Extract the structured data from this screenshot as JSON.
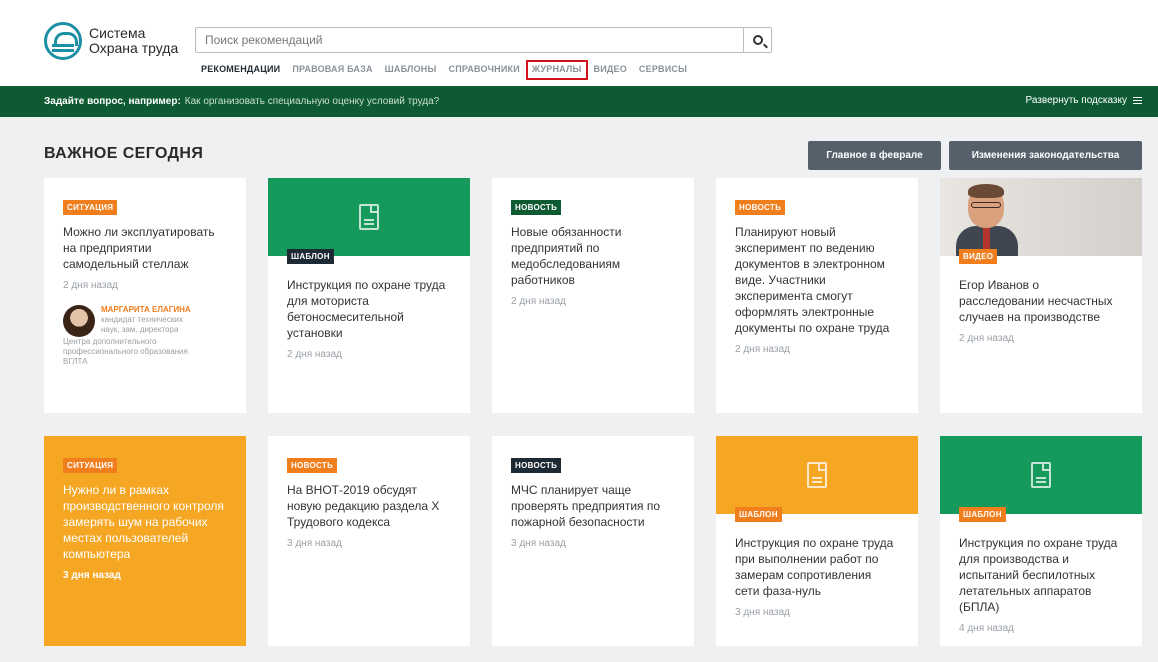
{
  "logo": {
    "line1": "Система",
    "line2": "Охрана труда"
  },
  "search": {
    "placeholder": "Поиск рекомендаций",
    "icon": "search-icon"
  },
  "nav": {
    "items": [
      {
        "label": "РЕКОМЕНДАЦИИ",
        "state": "active"
      },
      {
        "label": "ПРАВОВАЯ БАЗА",
        "state": ""
      },
      {
        "label": "ШАБЛОНЫ",
        "state": ""
      },
      {
        "label": "СПРАВОЧНИКИ",
        "state": ""
      },
      {
        "label": "ЖУРНАЛЫ",
        "state": "highlighted"
      },
      {
        "label": "ВИДЕО",
        "state": ""
      },
      {
        "label": "СЕРВИСЫ",
        "state": ""
      }
    ]
  },
  "hint": {
    "question": "Задайте вопрос, например:",
    "example": "Как организовать специальную оценку условий труда?",
    "expand": "Развернуть подсказку"
  },
  "section": {
    "title": "ВАЖНОЕ СЕГОДНЯ",
    "button_feb": "Главное в феврале",
    "button_law": "Изменения законодательства"
  },
  "cards": [
    {
      "badge": "СИТУАЦИЯ",
      "title": "Можно ли эксплуатировать на предприятии самодельный стеллаж",
      "date": "2 дня назад",
      "author": {
        "name": "МАРГАРИТА ЕЛАГИНА",
        "role_line1": "кандидат технических",
        "role_line2": "наук, зам. директора",
        "role_rest": "Центра дополнительного профессионального образования ВГЛТА"
      }
    },
    {
      "badge": "ШАБЛОН",
      "title": "Инструкция по охране труда для моториста бетоносмесительной установки",
      "date": "2 дня назад"
    },
    {
      "badge": "НОВОСТЬ",
      "title": "Новые обязанности предприятий по медобследованиям работников",
      "date": "2 дня назад"
    },
    {
      "badge": "НОВОСТЬ",
      "title": "Планируют новый эксперимент по ведению документов в электронном виде. Участники эксперимента смогут оформлять электронные документы по охране труда",
      "date": "2 дня назад"
    },
    {
      "badge": "ВИДЕО",
      "title": "Егор Иванов о расследовании несчастных случаев на производстве",
      "date": "2 дня назад"
    },
    {
      "badge": "СИТУАЦИЯ",
      "title": "Нужно ли в рамках производственного контроля замерять шум на рабочих местах пользователей компьютера",
      "date": "3 дня назад"
    },
    {
      "badge": "НОВОСТЬ",
      "title": "На ВНОТ-2019 обсудят новую редакцию раздела X Трудового кодекса",
      "date": "3 дня назад"
    },
    {
      "badge": "НОВОСТЬ",
      "title": "МЧС планирует чаще проверять предприятия по пожарной безопасности",
      "date": "3 дня назад"
    },
    {
      "badge": "ШАБЛОН",
      "title": "Инструкция по охране труда при выполнении работ по замерам сопротивления сети фаза-нуль",
      "date": "3 дня назад"
    },
    {
      "badge": "ШАБЛОН",
      "title": "Инструкция по охране труда для производства и испытаний беспилотных летательных аппаратов (БПЛА)",
      "date": "4 дня назад"
    }
  ],
  "colors": {
    "accent_green": "#0e5a33",
    "card_green": "#159a5c",
    "card_orange": "#f5a623",
    "badge_orange": "#f07e1c",
    "highlight_red": "#d3121d"
  }
}
